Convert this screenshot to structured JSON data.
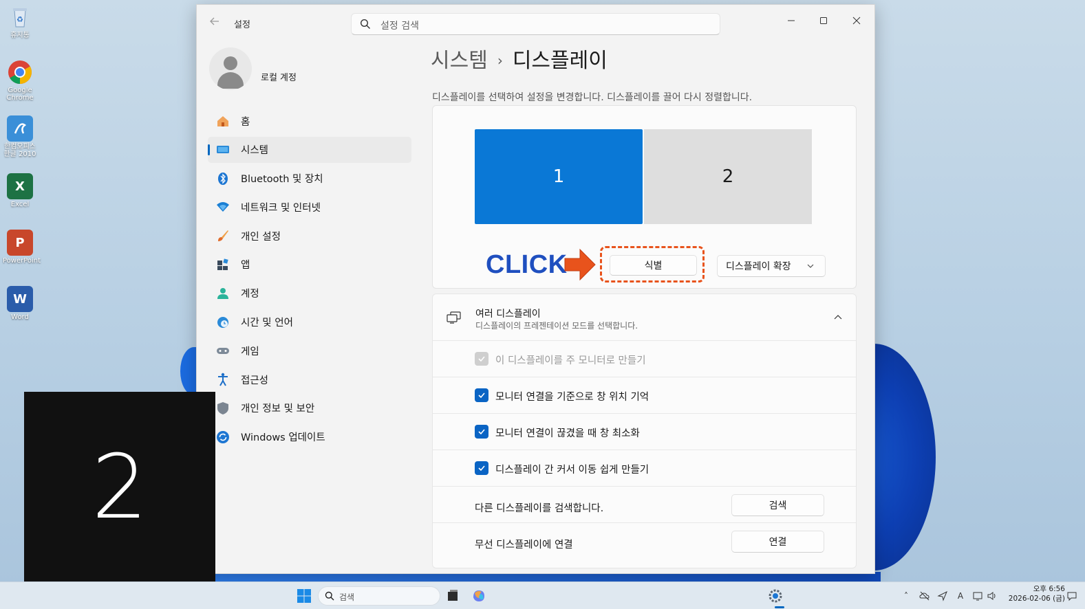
{
  "desktop": {
    "icons": [
      {
        "label": "휴지통",
        "icon": "recycle-bin-icon"
      },
      {
        "label": "Google Chrome",
        "icon": "chrome-icon"
      },
      {
        "label": "한컴오피스 한글 2010",
        "icon": "hancom-icon"
      },
      {
        "label": "Excel",
        "icon": "excel-icon"
      },
      {
        "label": "PowerPoint",
        "icon": "powerpoint-icon"
      },
      {
        "label": "Word",
        "icon": "word-icon"
      }
    ],
    "identify_number": "2"
  },
  "window": {
    "app_title": "설정",
    "search_placeholder": "설정 검색",
    "profile_name": "로컬 계정"
  },
  "sidebar": {
    "items": [
      {
        "label": "홈",
        "icon": "home-icon",
        "active": false
      },
      {
        "label": "시스템",
        "icon": "system-icon",
        "active": true
      },
      {
        "label": "Bluetooth 및 장치",
        "icon": "bluetooth-icon",
        "active": false
      },
      {
        "label": "네트워크 및 인터넷",
        "icon": "network-icon",
        "active": false
      },
      {
        "label": "개인 설정",
        "icon": "brush-icon",
        "active": false
      },
      {
        "label": "앱",
        "icon": "apps-icon",
        "active": false
      },
      {
        "label": "계정",
        "icon": "account-icon",
        "active": false
      },
      {
        "label": "시간 및 언어",
        "icon": "time-language-icon",
        "active": false
      },
      {
        "label": "게임",
        "icon": "gamepad-icon",
        "active": false
      },
      {
        "label": "접근성",
        "icon": "accessibility-icon",
        "active": false
      },
      {
        "label": "개인 정보 및 보안",
        "icon": "shield-icon",
        "active": false
      },
      {
        "label": "Windows 업데이트",
        "icon": "update-icon",
        "active": false
      }
    ]
  },
  "main": {
    "breadcrumb_parent": "시스템",
    "breadcrumb_separator": "›",
    "breadcrumb_current": "디스플레이",
    "description": "디스플레이를 선택하여 설정을 변경합니다. 디스플레이를 끌어 다시 정렬합니다.",
    "monitors": [
      "1",
      "2"
    ],
    "click_annotation": "CLICK",
    "identify_label": "식별",
    "extend_selected": "디스플레이 확장"
  },
  "multi_display": {
    "title": "여러 디스플레이",
    "subtitle": "디스플레이의 프레젠테이션 모드를 선택합니다.",
    "options": [
      {
        "label": "이 디스플레이를 주 모니터로 만들기",
        "checked": true,
        "disabled": true
      },
      {
        "label": "모니터 연결을 기준으로 창 위치 기억",
        "checked": true,
        "disabled": false
      },
      {
        "label": "모니터 연결이 끊겼을 때 창 최소화",
        "checked": true,
        "disabled": false
      },
      {
        "label": "디스플레이 간 커서 이동 쉽게 만들기",
        "checked": true,
        "disabled": false
      }
    ],
    "detect_label": "다른 디스플레이를 검색합니다.",
    "detect_button": "검색",
    "wireless_label": "무선 디스플레이에 연결",
    "wireless_button": "연결"
  },
  "taskbar": {
    "search_placeholder": "검색",
    "time": "오후 6:56",
    "date": "2026-02-06 (금)"
  },
  "colors": {
    "accent": "#0067c0",
    "monitor_selected": "#0a78d6",
    "click_text": "#1f4fbf",
    "highlight": "#e8531c"
  }
}
